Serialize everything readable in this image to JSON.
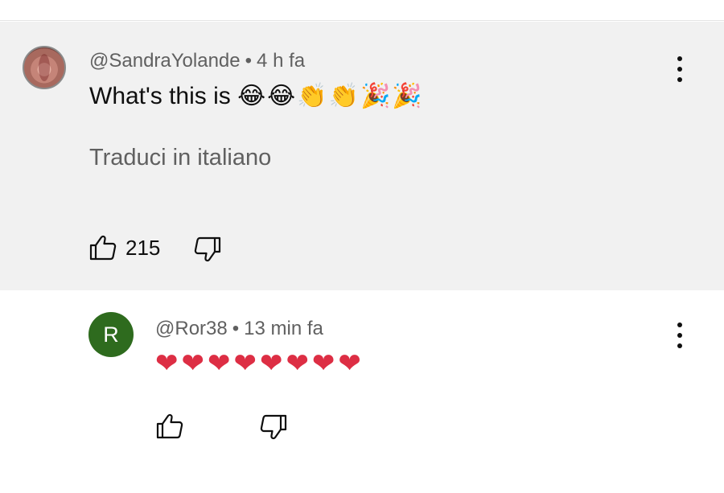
{
  "comment": {
    "author": "@SandraYolande",
    "time": "4 h fa",
    "text": "What's this is",
    "emojis": "😂😂👏👏🎉🎉",
    "translate_label": "Traduci in italiano",
    "like_count": "215",
    "avatar_icon": "profile-photo"
  },
  "reply": {
    "avatar_letter": "R",
    "avatar_color": "#2e6b1e",
    "author": "@Ror38",
    "time": "13 min fa",
    "emojis": "❤❤❤❤❤❤❤❤"
  },
  "separator": "•",
  "icons": {
    "like": "thumbs-up-icon",
    "dislike": "thumbs-down-icon",
    "more": "more-vertical-icon"
  },
  "colors": {
    "highlight_bg": "#f1f1f1",
    "meta_text": "#606060",
    "heart": "#dd2e44"
  }
}
